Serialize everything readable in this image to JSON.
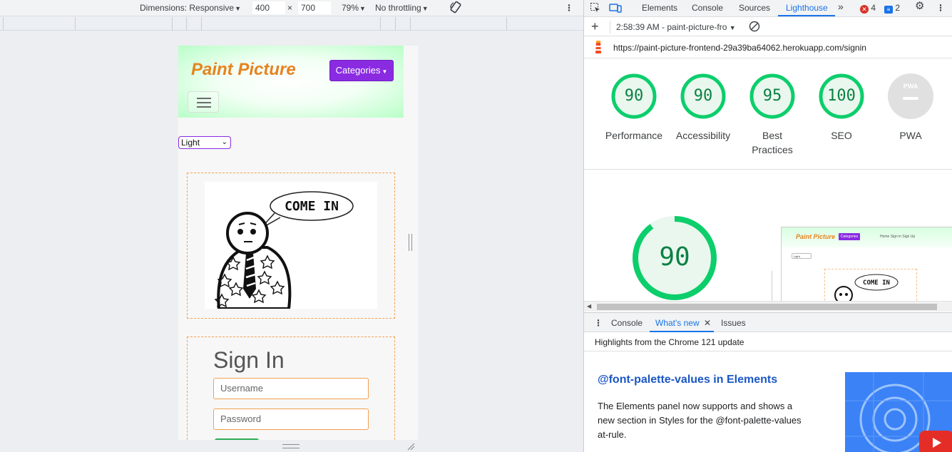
{
  "device_toolbar": {
    "dimensions_label": "Dimensions: Responsive",
    "width_value": "400",
    "times_sign": "×",
    "height_value": "700",
    "zoom": "79%",
    "throttling": "No throttling"
  },
  "site": {
    "brand": "Paint Picture",
    "categories_label": "Categories",
    "theme_select_value": "Light",
    "comic_speech": "COME IN",
    "signin_title": "Sign In",
    "username_placeholder": "Username",
    "password_placeholder": "Password"
  },
  "devtools": {
    "tabs": [
      "Elements",
      "Console",
      "Sources",
      "Lighthouse"
    ],
    "active_tab": "Lighthouse",
    "error_count": "4",
    "message_count": "2",
    "report_time": "2:58:39 AM - paint-picture-fro",
    "url": "https://paint-picture-frontend-29a39ba64062.herokuapp.com/signin",
    "scores": [
      {
        "value": 90,
        "label": "Performance"
      },
      {
        "value": 90,
        "label": "Accessibility"
      },
      {
        "value": 95,
        "label": "Best Practices"
      },
      {
        "value": 100,
        "label": "SEO"
      }
    ],
    "pwa_label": "PWA",
    "pwa_icon_text": "PWA",
    "big_score": 90,
    "thumbnail": {
      "brand": "Paint Picture",
      "categories": "Categories",
      "links": "Home   Sign in   Sign Up",
      "select": "Light",
      "comic_speech": "COME IN"
    },
    "drawer": {
      "tabs": [
        "Console",
        "What's new",
        "Issues"
      ],
      "active_tab": "What's new",
      "subtitle": "Highlights from the Chrome 121 update",
      "feature_title": "@font-palette-values in Elements",
      "feature_body": "The Elements panel now supports and shows a new section in Styles for the @font-palette-values at-rule."
    }
  },
  "colors": {
    "score_green": "#0cce6b",
    "brand_orange": "#e6831f",
    "categories_purple": "#8a2be2",
    "devtools_blue": "#1a73e8"
  }
}
